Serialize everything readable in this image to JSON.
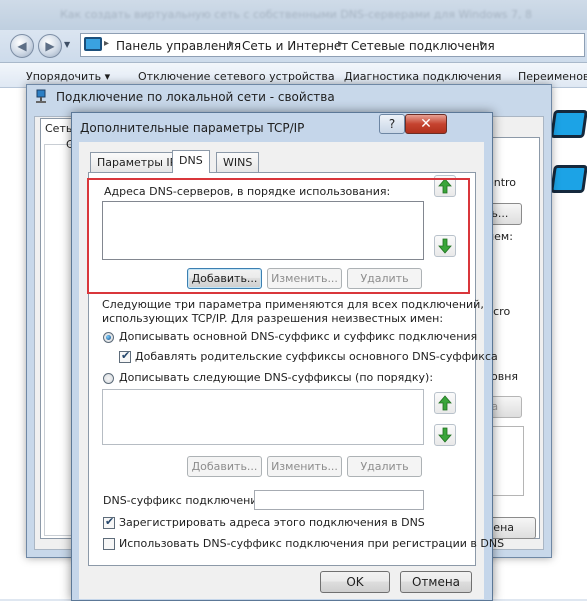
{
  "explorer": {
    "blurred_title": "Как создать виртуальную сеть с собственными DNS-серверами для Windows 7, 8",
    "breadcrumbs": [
      "Панель управления",
      "Сеть и Интернет",
      "Сетевые подключения"
    ],
    "commands": [
      "Упорядочить ▾",
      "Отключение сетевого устройства",
      "Диагностика подключения",
      "Переименов"
    ]
  },
  "properties": {
    "title": "Подключение по локальной сети - свойства",
    "tab": "Сеть",
    "right_texts": [
      "ontro",
      "ть...",
      "ием:",
      "licro",
      "ровня",
      "та",
      "мена"
    ]
  },
  "dialog": {
    "title": "Дополнительные параметры TCP/IP",
    "help": "?",
    "close": "✕",
    "tabs": [
      "Параметры IP",
      "DNS",
      "WINS"
    ],
    "dns_servers_label": "Адреса DNS-серверов, в порядке использования:",
    "buttons": {
      "add": "Добавить...",
      "edit": "Изменить...",
      "remove": "Удалить"
    },
    "info_text_1": "Следующие три параметра применяются для всех подключений,",
    "info_text_2": "использующих TCP/IP. Для разрешения неизвестных имен:",
    "radio_primary": "Дописывать основной DNS-суффикс и суффикс подключения",
    "check_parent": "Добавлять родительские суффиксы основного DNS-суффикса",
    "radio_suffixes": "Дописывать следующие DNS-суффиксы (по порядку):",
    "suffix_label": "DNS-суффикс подключения:",
    "suffix_value": "",
    "check_register": "Зарегистрировать адреса этого подключения в DNS",
    "check_use_suffix": "Использовать DNS-суффикс подключения при регистрации в DNS",
    "ok": "OK",
    "cancel": "Отмена"
  },
  "state": {
    "radio_primary_selected": true,
    "check_parent": true,
    "check_register": true,
    "check_use_suffix": false
  },
  "colors": {
    "highlight": "#d9363b",
    "arrow_green": "#2e9b2e"
  }
}
